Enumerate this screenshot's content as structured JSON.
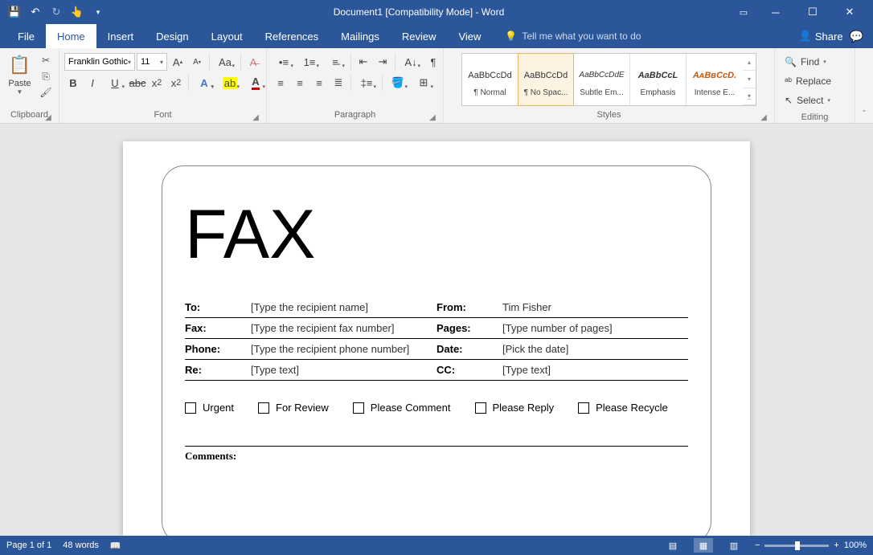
{
  "titlebar": {
    "title": "Document1 [Compatibility Mode]  -  Word"
  },
  "tabs": {
    "file": "File",
    "items": [
      "Home",
      "Insert",
      "Design",
      "Layout",
      "References",
      "Mailings",
      "Review",
      "View"
    ],
    "tellme": "Tell me what you want to do",
    "share": "Share"
  },
  "ribbon": {
    "clipboard": {
      "label": "Clipboard",
      "paste": "Paste"
    },
    "font": {
      "label": "Font",
      "name": "Franklin Gothic",
      "size": "11"
    },
    "paragraph": {
      "label": "Paragraph"
    },
    "styles": {
      "label": "Styles",
      "items": [
        {
          "preview": "AaBbCcDd",
          "name": "¶ Normal",
          "cls": ""
        },
        {
          "preview": "AaBbCcDd",
          "name": "¶ No Spac...",
          "cls": "sel"
        },
        {
          "preview": "AaBbCcDdE",
          "name": "Subtle Em...",
          "cls": "it"
        },
        {
          "preview": "AaBbCcL",
          "name": "Emphasis",
          "cls": "bi"
        },
        {
          "preview": "AᴀBʙCᴄD.",
          "name": "Intense E...",
          "cls": "or"
        }
      ]
    },
    "editing": {
      "label": "Editing",
      "find": "Find",
      "replace": "Replace",
      "select": "Select"
    }
  },
  "document": {
    "title": "FAX",
    "rows": [
      {
        "l_label": "To:",
        "l_val": "[Type the recipient name]",
        "r_label": "From:",
        "r_val": "Tim Fisher"
      },
      {
        "l_label": "Fax:",
        "l_val": "[Type the recipient fax number]",
        "r_label": "Pages:",
        "r_val": "[Type number of pages]"
      },
      {
        "l_label": "Phone:",
        "l_val": "[Type the recipient phone number]",
        "r_label": "Date:",
        "r_val": "[Pick the date]"
      },
      {
        "l_label": "Re:",
        "l_val": "[Type text]",
        "r_label": "CC:",
        "r_val": "[Type text]"
      }
    ],
    "checks": [
      "Urgent",
      "For Review",
      "Please Comment",
      "Please Reply",
      "Please Recycle"
    ],
    "comments": "Comments:"
  },
  "statusbar": {
    "page": "Page 1 of 1",
    "words": "48 words",
    "zoom": "100%"
  }
}
